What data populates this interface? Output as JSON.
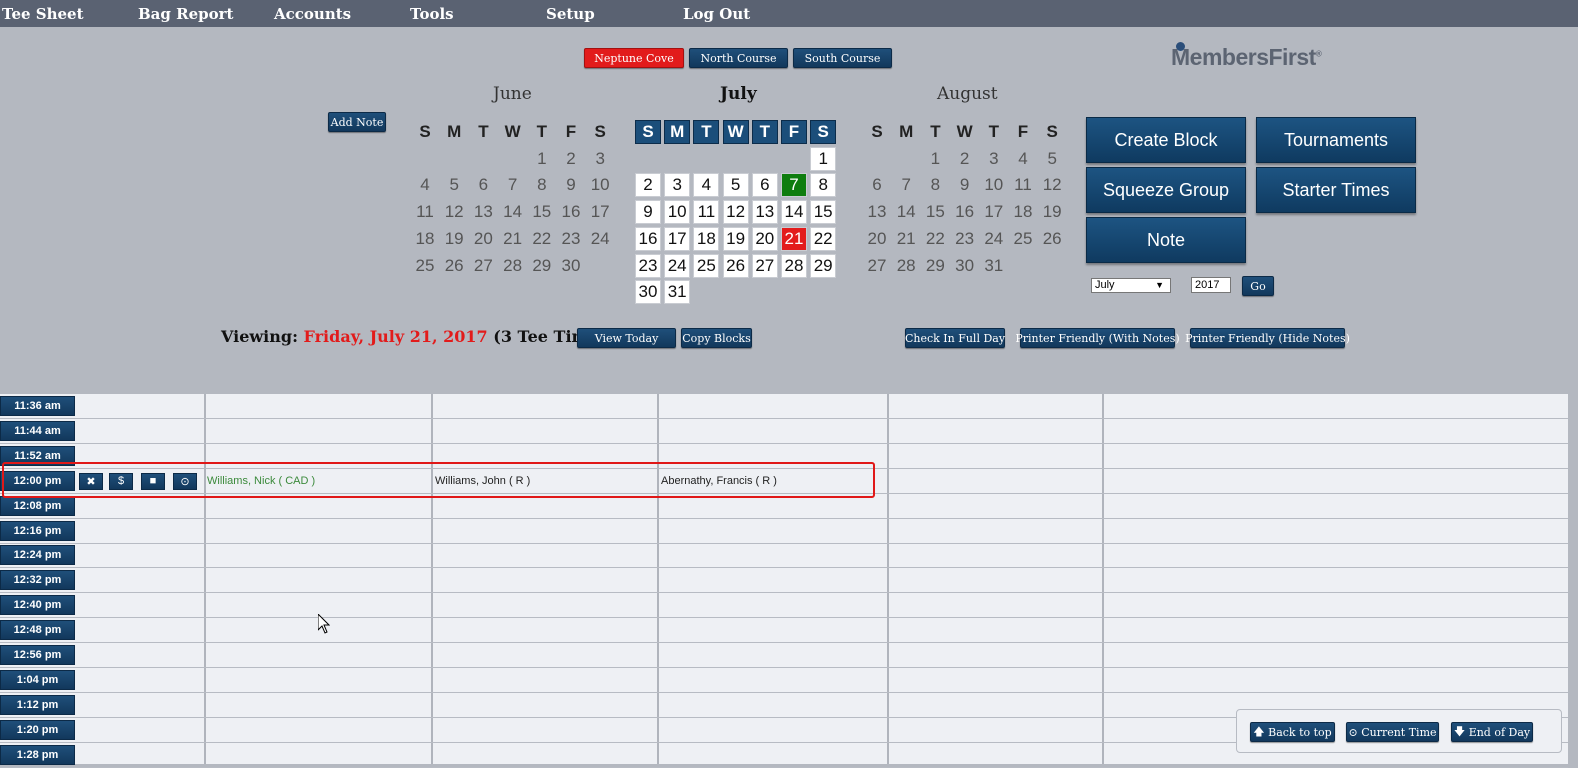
{
  "nav": {
    "items": [
      "Tee Sheet",
      "Bag Report",
      "Accounts",
      "Tools",
      "Setup",
      "Log Out"
    ]
  },
  "courses": [
    "Neptune Cove",
    "North Course",
    "South Course"
  ],
  "logo": {
    "text_a": "Members",
    "text_b": "First"
  },
  "add_note_label": "Add Note",
  "calendar": {
    "weekdays": [
      "S",
      "M",
      "T",
      "W",
      "T",
      "F",
      "S"
    ],
    "months": [
      {
        "name": "June",
        "days": [
          [
            "",
            "",
            "",
            "",
            "1",
            "2",
            "3"
          ],
          [
            "4",
            "5",
            "6",
            "7",
            "8",
            "9",
            "10"
          ],
          [
            "11",
            "12",
            "13",
            "14",
            "15",
            "16",
            "17"
          ],
          [
            "18",
            "19",
            "20",
            "21",
            "22",
            "23",
            "24"
          ],
          [
            "25",
            "26",
            "27",
            "28",
            "29",
            "30",
            ""
          ]
        ]
      },
      {
        "name": "July",
        "days": [
          [
            "",
            "",
            "",
            "",
            "",
            "",
            "1"
          ],
          [
            "2",
            "3",
            "4",
            "5",
            "6",
            "7",
            "8"
          ],
          [
            "9",
            "10",
            "11",
            "12",
            "13",
            "14",
            "15"
          ],
          [
            "16",
            "17",
            "18",
            "19",
            "20",
            "21",
            "22"
          ],
          [
            "23",
            "24",
            "25",
            "26",
            "27",
            "28",
            "29"
          ],
          [
            "30",
            "31",
            "",
            "",
            "",
            "",
            ""
          ]
        ]
      },
      {
        "name": "August",
        "days": [
          [
            "",
            "",
            "1",
            "2",
            "3",
            "4",
            "5"
          ],
          [
            "6",
            "7",
            "8",
            "9",
            "10",
            "11",
            "12"
          ],
          [
            "13",
            "14",
            "15",
            "16",
            "17",
            "18",
            "19"
          ],
          [
            "20",
            "21",
            "22",
            "23",
            "24",
            "25",
            "26"
          ],
          [
            "27",
            "28",
            "29",
            "30",
            "31",
            "",
            ""
          ]
        ]
      }
    ],
    "selected_day": "21",
    "today_day": "7"
  },
  "actions": {
    "create_block": "Create Block",
    "tournaments": "Tournaments",
    "squeeze_group": "Squeeze Group",
    "starter_times": "Starter Times",
    "note": "Note"
  },
  "month_select": {
    "value": "July"
  },
  "year_input": {
    "value": "2017"
  },
  "go_label": "Go",
  "viewing": {
    "label": "Viewing:",
    "date": "Friday, July 21, 2017",
    "count": "(3 Tee Times)"
  },
  "toolbar": {
    "view_today": "View Today",
    "copy_blocks": "Copy Blocks",
    "check_in": "Check In Full Day",
    "print_with": "Printer Friendly (With Notes)",
    "print_hide": "Printer Friendly (Hide Notes)"
  },
  "tee_times": [
    "11:36 am",
    "11:44 am",
    "11:52 am",
    "12:00 pm",
    "12:08 pm",
    "12:16 pm",
    "12:24 pm",
    "12:32 pm",
    "12:40 pm",
    "12:48 pm",
    "12:56 pm",
    "1:04 pm",
    "1:12 pm",
    "1:20 pm",
    "1:28 pm"
  ],
  "booked_row": {
    "time": "12:00 pm",
    "players": [
      {
        "name": "Williams, Nick   ( CAD )",
        "color": "#3b8a3b"
      },
      {
        "name": "Williams, John  ( R )",
        "color": "#222222"
      },
      {
        "name": "Abernathy, Francis   ( R )",
        "color": "#222222"
      }
    ],
    "icons": [
      "close-icon",
      "dollar-icon",
      "square-icon",
      "clock-icon"
    ]
  },
  "floatbar": {
    "back_to_top": "Back to top",
    "current_time": "Current Time",
    "end_of_day": "End of Day"
  },
  "colors": {
    "accent": "#1b4e7a",
    "selected": "#e31c1c",
    "today": "#0e7d0e",
    "nav_bg": "#5a6272"
  }
}
